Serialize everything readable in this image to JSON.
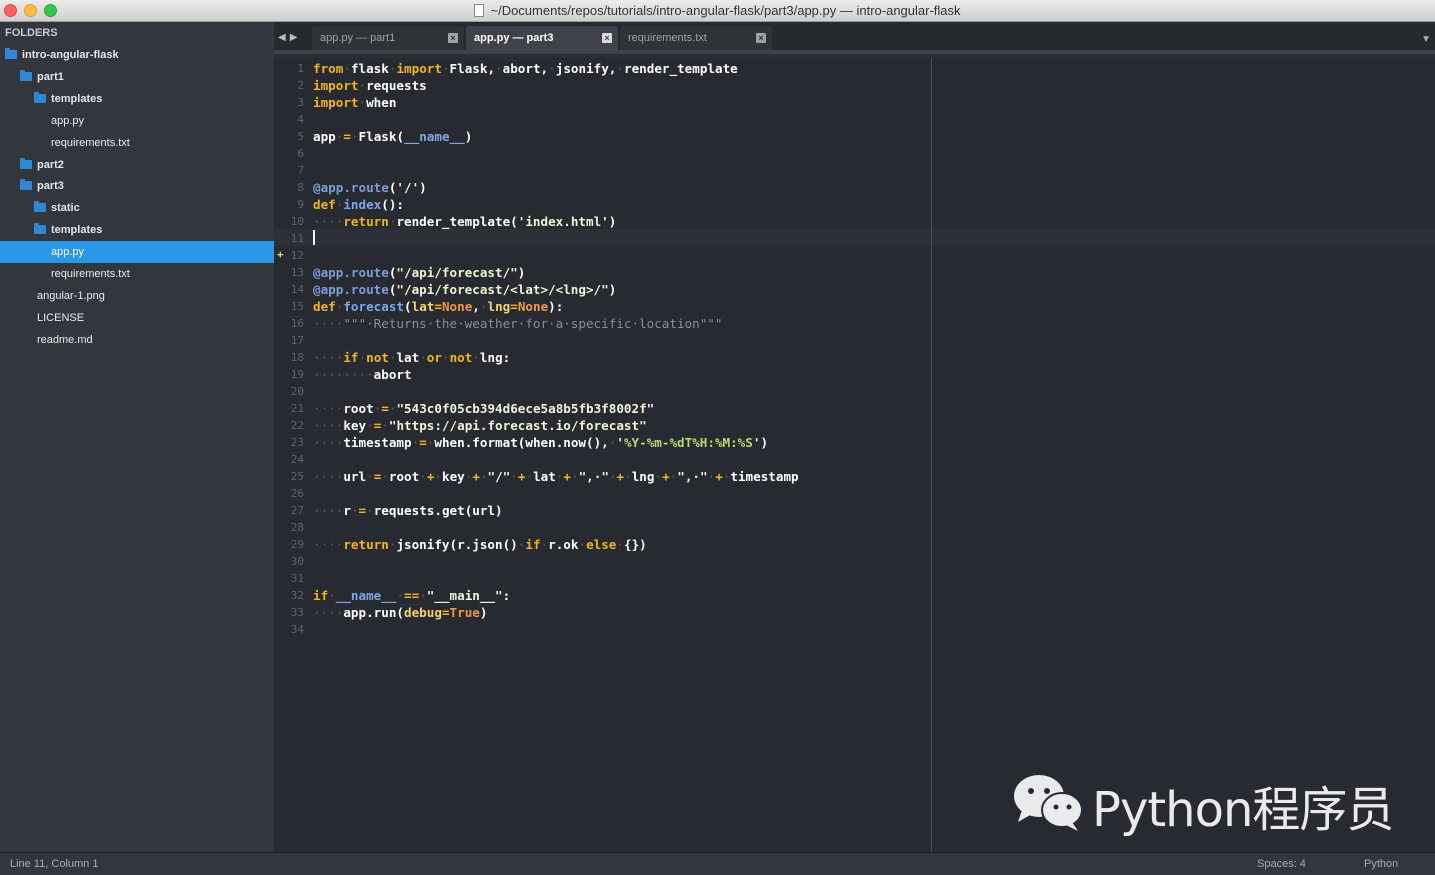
{
  "window": {
    "title": "~/Documents/repos/tutorials/intro-angular-flask/part3/app.py — intro-angular-flask"
  },
  "sidebar": {
    "header": "FOLDERS",
    "tree": [
      {
        "label": "intro-angular-flask",
        "kind": "folder",
        "level": 0
      },
      {
        "label": "part1",
        "kind": "folder",
        "level": 1
      },
      {
        "label": "templates",
        "kind": "folder",
        "level": 2
      },
      {
        "label": "app.py",
        "kind": "file",
        "level": 2
      },
      {
        "label": "requirements.txt",
        "kind": "file",
        "level": 2
      },
      {
        "label": "part2",
        "kind": "folder",
        "level": 1
      },
      {
        "label": "part3",
        "kind": "folder",
        "level": 1
      },
      {
        "label": "static",
        "kind": "folder",
        "level": 2
      },
      {
        "label": "templates",
        "kind": "folder",
        "level": 2
      },
      {
        "label": "app.py",
        "kind": "file",
        "level": 2,
        "selected": true
      },
      {
        "label": "requirements.txt",
        "kind": "file",
        "level": 2
      },
      {
        "label": "angular-1.png",
        "kind": "file",
        "level": 1
      },
      {
        "label": "LICENSE",
        "kind": "file",
        "level": 1
      },
      {
        "label": "readme.md",
        "kind": "file",
        "level": 1
      }
    ]
  },
  "tabs": [
    {
      "label": "app.py — part1",
      "active": false
    },
    {
      "label": "app.py — part3",
      "active": true
    },
    {
      "label": "requirements.txt",
      "active": false
    }
  ],
  "tab_close_glyph": "×",
  "editor": {
    "current_line": 11,
    "modified_line": 12,
    "lines": [
      [
        [
          "kw",
          "from"
        ],
        [
          "ws",
          "·"
        ],
        [
          "t",
          "flask"
        ],
        [
          "ws",
          "·"
        ],
        [
          "kw",
          "import"
        ],
        [
          "ws",
          "·"
        ],
        [
          "t",
          "Flask,"
        ],
        [
          "ws",
          "·"
        ],
        [
          "t",
          "abort,"
        ],
        [
          "ws",
          "·"
        ],
        [
          "t",
          "jsonify,"
        ],
        [
          "ws",
          "·"
        ],
        [
          "t",
          "render_template"
        ]
      ],
      [
        [
          "kw",
          "import"
        ],
        [
          "ws",
          "·"
        ],
        [
          "t",
          "requests"
        ]
      ],
      [
        [
          "kw",
          "import"
        ],
        [
          "ws",
          "·"
        ],
        [
          "t",
          "when"
        ]
      ],
      [],
      [
        [
          "t",
          "app"
        ],
        [
          "ws",
          "·"
        ],
        [
          "op",
          "="
        ],
        [
          "ws",
          "·"
        ],
        [
          "t",
          "Flask("
        ],
        [
          "fn",
          "__name__"
        ],
        [
          "t",
          ")"
        ]
      ],
      [],
      [],
      [
        [
          "dec",
          "@app.route"
        ],
        [
          "t",
          "("
        ],
        [
          "str",
          "'/'"
        ],
        [
          "t",
          ")"
        ]
      ],
      [
        [
          "kw",
          "def"
        ],
        [
          "ws",
          "·"
        ],
        [
          "fn",
          "index"
        ],
        [
          "t",
          "():"
        ]
      ],
      [
        [
          "ws",
          "····"
        ],
        [
          "kw",
          "return"
        ],
        [
          "ws",
          "·"
        ],
        [
          "t",
          "render_template("
        ],
        [
          "str",
          "'index.html'"
        ],
        [
          "t",
          ")"
        ]
      ],
      [],
      [],
      [
        [
          "dec",
          "@app.route"
        ],
        [
          "t",
          "("
        ],
        [
          "str",
          "\"/api/forecast/\""
        ],
        [
          "t",
          ")"
        ]
      ],
      [
        [
          "dec",
          "@app.route"
        ],
        [
          "t",
          "("
        ],
        [
          "str",
          "\"/api/forecast/<lat>/<lng>/\""
        ],
        [
          "t",
          ")"
        ]
      ],
      [
        [
          "kw",
          "def"
        ],
        [
          "ws",
          "·"
        ],
        [
          "fn",
          "forecast"
        ],
        [
          "t",
          "("
        ],
        [
          "param",
          "lat"
        ],
        [
          "op",
          "="
        ],
        [
          "const",
          "None"
        ],
        [
          "t",
          ","
        ],
        [
          "ws",
          "·"
        ],
        [
          "param",
          "lng"
        ],
        [
          "op",
          "="
        ],
        [
          "const",
          "None"
        ],
        [
          "t",
          "):"
        ]
      ],
      [
        [
          "ws",
          "····"
        ],
        [
          "com",
          "\"\"\"·Returns·the·weather·for·a·specific·location\"\"\""
        ]
      ],
      [],
      [
        [
          "ws",
          "····"
        ],
        [
          "kw",
          "if"
        ],
        [
          "ws",
          "·"
        ],
        [
          "kw",
          "not"
        ],
        [
          "ws",
          "·"
        ],
        [
          "t",
          "lat"
        ],
        [
          "ws",
          "·"
        ],
        [
          "kw",
          "or"
        ],
        [
          "ws",
          "·"
        ],
        [
          "kw",
          "not"
        ],
        [
          "ws",
          "·"
        ],
        [
          "t",
          "lng:"
        ]
      ],
      [
        [
          "ws",
          "········"
        ],
        [
          "t",
          "abort"
        ]
      ],
      [],
      [
        [
          "ws",
          "····"
        ],
        [
          "t",
          "root"
        ],
        [
          "ws",
          "·"
        ],
        [
          "op",
          "="
        ],
        [
          "ws",
          "·"
        ],
        [
          "str",
          "\"543c0f05cb394d6ece5a8b5fb3f8002f\""
        ]
      ],
      [
        [
          "ws",
          "····"
        ],
        [
          "t",
          "key"
        ],
        [
          "ws",
          "·"
        ],
        [
          "op",
          "="
        ],
        [
          "ws",
          "·"
        ],
        [
          "str",
          "\"https://api.forecast.io/forecast\""
        ]
      ],
      [
        [
          "ws",
          "····"
        ],
        [
          "t",
          "timestamp"
        ],
        [
          "ws",
          "·"
        ],
        [
          "op",
          "="
        ],
        [
          "ws",
          "·"
        ],
        [
          "t",
          "when.format(when.now(),"
        ],
        [
          "ws",
          "·"
        ],
        [
          "str",
          "'"
        ],
        [
          "fmt",
          "%Y-%m-%dT%H:%M:%S"
        ],
        [
          "str",
          "'"
        ],
        [
          "t",
          ")"
        ]
      ],
      [],
      [
        [
          "ws",
          "····"
        ],
        [
          "t",
          "url"
        ],
        [
          "ws",
          "·"
        ],
        [
          "op",
          "="
        ],
        [
          "ws",
          "·"
        ],
        [
          "t",
          "root"
        ],
        [
          "ws",
          "·"
        ],
        [
          "op",
          "+"
        ],
        [
          "ws",
          "·"
        ],
        [
          "t",
          "key"
        ],
        [
          "ws",
          "·"
        ],
        [
          "op",
          "+"
        ],
        [
          "ws",
          "·"
        ],
        [
          "str",
          "\"/\""
        ],
        [
          "ws",
          "·"
        ],
        [
          "op",
          "+"
        ],
        [
          "ws",
          "·"
        ],
        [
          "t",
          "lat"
        ],
        [
          "ws",
          "·"
        ],
        [
          "op",
          "+"
        ],
        [
          "ws",
          "·"
        ],
        [
          "str",
          "\",·\""
        ],
        [
          "ws",
          "·"
        ],
        [
          "op",
          "+"
        ],
        [
          "ws",
          "·"
        ],
        [
          "t",
          "lng"
        ],
        [
          "ws",
          "·"
        ],
        [
          "op",
          "+"
        ],
        [
          "ws",
          "·"
        ],
        [
          "str",
          "\",·\""
        ],
        [
          "ws",
          "·"
        ],
        [
          "op",
          "+"
        ],
        [
          "ws",
          "·"
        ],
        [
          "t",
          "timestamp"
        ]
      ],
      [],
      [
        [
          "ws",
          "····"
        ],
        [
          "t",
          "r"
        ],
        [
          "ws",
          "·"
        ],
        [
          "op",
          "="
        ],
        [
          "ws",
          "·"
        ],
        [
          "t",
          "requests.get(url)"
        ]
      ],
      [],
      [
        [
          "ws",
          "····"
        ],
        [
          "kw",
          "return"
        ],
        [
          "ws",
          "·"
        ],
        [
          "t",
          "jsonify(r.json()"
        ],
        [
          "ws",
          "·"
        ],
        [
          "kw",
          "if"
        ],
        [
          "ws",
          "·"
        ],
        [
          "t",
          "r.ok"
        ],
        [
          "ws",
          "·"
        ],
        [
          "kw",
          "else"
        ],
        [
          "ws",
          "·"
        ],
        [
          "t",
          "{})"
        ]
      ],
      [],
      [],
      [
        [
          "kw",
          "if"
        ],
        [
          "ws",
          "·"
        ],
        [
          "fn",
          "__name__"
        ],
        [
          "ws",
          "·"
        ],
        [
          "op",
          "=="
        ],
        [
          "ws",
          "·"
        ],
        [
          "str",
          "\"__main__\""
        ],
        [
          "t",
          ":"
        ]
      ],
      [
        [
          "ws",
          "····"
        ],
        [
          "t",
          "app.run("
        ],
        [
          "param",
          "debug"
        ],
        [
          "op",
          "="
        ],
        [
          "const",
          "True"
        ],
        [
          "t",
          ")"
        ]
      ],
      []
    ]
  },
  "statusbar": {
    "position": "Line 11, Column 1",
    "indent": "Spaces: 4",
    "syntax": "Python"
  },
  "watermark": {
    "text": "Python程序员"
  },
  "colors": {
    "keyword": "#f2b51d",
    "decorator": "#7b9ed8",
    "selection": "#2997e6",
    "folder": "#2f88d6"
  }
}
